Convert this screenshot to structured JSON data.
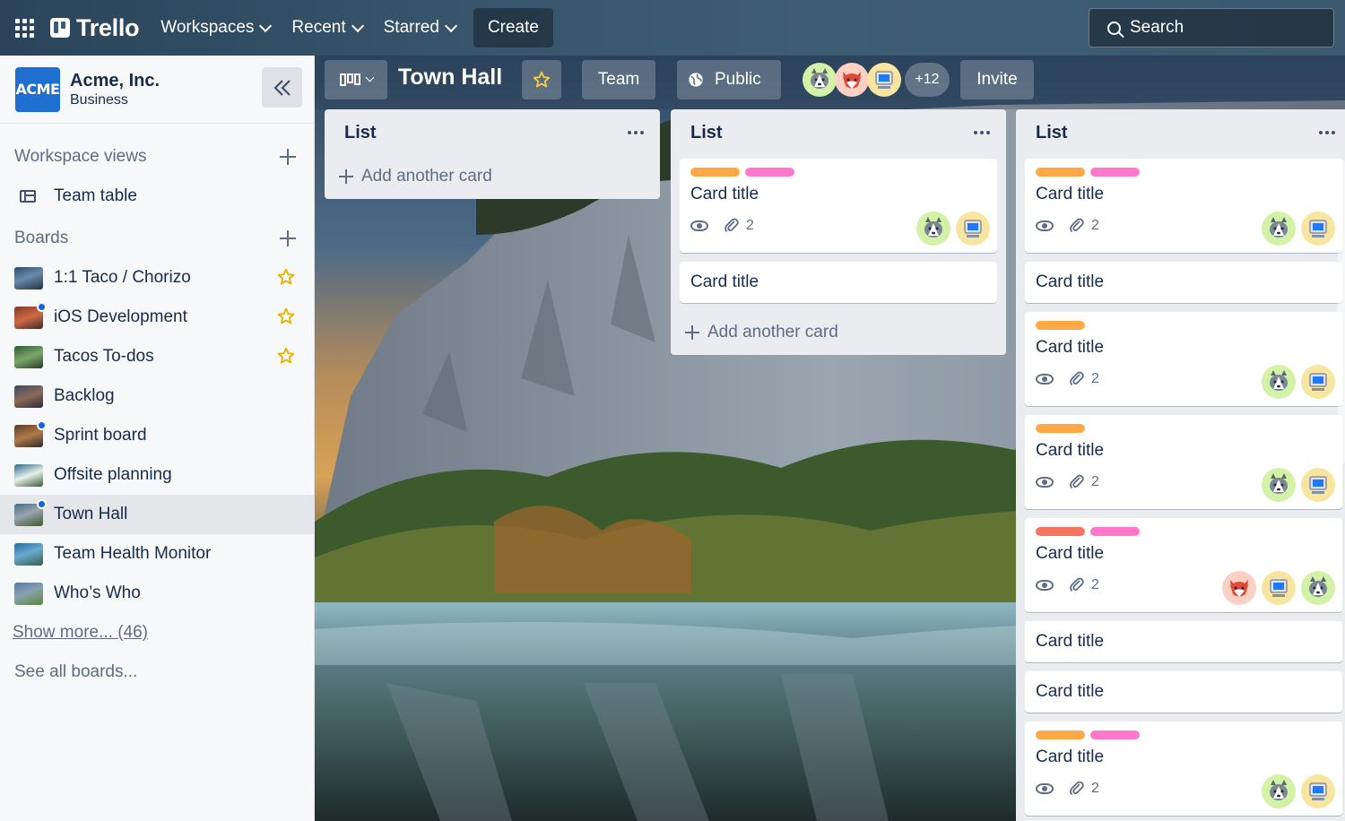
{
  "nav": {
    "logo_text": "Trello",
    "workspaces": "Workspaces",
    "recent": "Recent",
    "starred": "Starred",
    "create": "Create",
    "search": "Search"
  },
  "sidebar": {
    "workspace_logo": "ACME",
    "workspace_name": "Acme, Inc.",
    "workspace_plan": "Business",
    "views_heading": "Workspace views",
    "views": [
      {
        "label": "Team table",
        "icon": "table-icon"
      }
    ],
    "boards_heading": "Boards",
    "boards": [
      {
        "label": "1:1 Taco / Chorizo",
        "starred": true,
        "notification": false
      },
      {
        "label": "iOS Development",
        "starred": true,
        "notification": true
      },
      {
        "label": "Tacos To-dos",
        "starred": true,
        "notification": false
      },
      {
        "label": "Backlog",
        "starred": false,
        "notification": false
      },
      {
        "label": "Sprint board",
        "starred": false,
        "notification": true
      },
      {
        "label": "Offsite planning",
        "starred": false,
        "notification": false
      },
      {
        "label": "Town Hall",
        "starred": false,
        "notification": true,
        "active": true
      },
      {
        "label": "Team Health Monitor",
        "starred": false,
        "notification": false
      },
      {
        "label": "Who’s Who",
        "starred": false,
        "notification": false
      }
    ],
    "show_more": "Show more... (46)",
    "see_all": "See all boards..."
  },
  "board": {
    "title": "Town Hall",
    "team_btn": "Team",
    "public_btn": "Public",
    "member_overflow": "+12",
    "invite_btn": "Invite"
  },
  "lists": [
    {
      "title": "List",
      "add_card": "Add another card"
    },
    {
      "title": "List",
      "add_card": "Add another card",
      "cards": [
        {
          "title": "Card title",
          "attachments": "2"
        },
        {
          "title": "Card title"
        }
      ]
    },
    {
      "title": "List",
      "cards": [
        {
          "title": "Card title",
          "attachments": "2"
        },
        {
          "title": "Card title"
        },
        {
          "title": "Card title",
          "attachments": "2"
        },
        {
          "title": "Card title",
          "attachments": "2"
        },
        {
          "title": "Card title",
          "attachments": "2"
        },
        {
          "title": "Card title"
        },
        {
          "title": "Card title"
        },
        {
          "title": "Card title",
          "attachments": "2"
        }
      ]
    }
  ],
  "colors": {
    "label_orange": "#ffa845",
    "label_pink": "#ff78cb",
    "label_red": "#f87462",
    "accent_blue": "#0c66e4",
    "star_yellow": "#f5cd47"
  }
}
